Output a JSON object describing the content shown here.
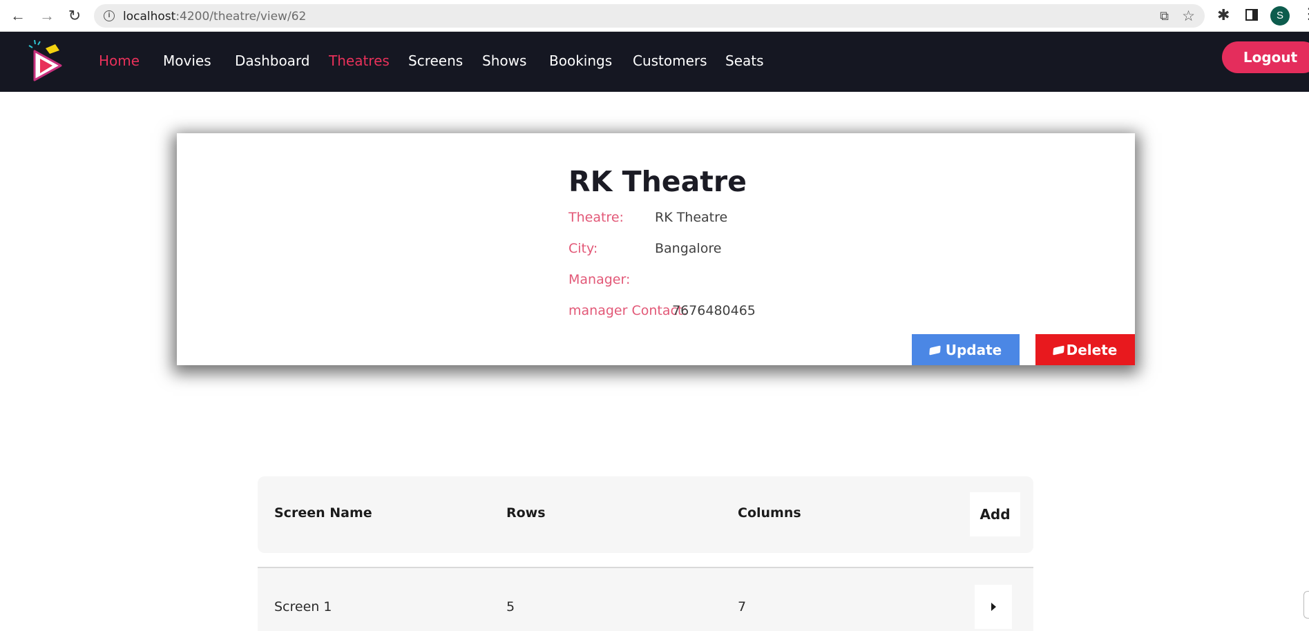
{
  "browser": {
    "url_host": "localhost",
    "url_path": ":4200/theatre/view/62",
    "profile_initial": "S"
  },
  "nav": {
    "items": [
      {
        "label": "Home",
        "active": true
      },
      {
        "label": "Movies",
        "active": false
      },
      {
        "label": "Dashboard",
        "active": false
      },
      {
        "label": "Theatres",
        "active": true
      },
      {
        "label": "Screens",
        "active": false
      },
      {
        "label": "Shows",
        "active": false
      },
      {
        "label": "Bookings",
        "active": false
      },
      {
        "label": "Customers",
        "active": false
      },
      {
        "label": "Seats",
        "active": false
      }
    ],
    "logout_label": "Logout",
    "colors": {
      "background": "#151722",
      "active": "#e8315a",
      "logout": "#e42d5c"
    }
  },
  "theatre": {
    "title": "RK Theatre",
    "fields": [
      {
        "label": "Theatre:",
        "value": "RK Theatre"
      },
      {
        "label": "City:",
        "value": "Bangalore"
      },
      {
        "label": "Manager:",
        "value": ""
      },
      {
        "label": "manager Contact:",
        "value": "7676480465"
      }
    ],
    "update_label": "Update",
    "delete_label": "Delete",
    "colors": {
      "update": "#4b87e5",
      "delete": "#e8191e",
      "label": "#e25877"
    }
  },
  "screens_table": {
    "headers": [
      "Screen Name",
      "Rows",
      "Columns"
    ],
    "add_label": "Add",
    "rows": [
      {
        "screen_name": "Screen 1",
        "rows": "5",
        "columns": "7"
      }
    ]
  },
  "icons": [
    "back-arrow-icon",
    "forward-arrow-icon",
    "reload-icon",
    "info-icon",
    "share-icon",
    "star-icon",
    "extensions-icon",
    "side-panel-icon",
    "menu-kebab-icon",
    "app-logo-icon",
    "ticket-icon",
    "caret-right-icon"
  ]
}
